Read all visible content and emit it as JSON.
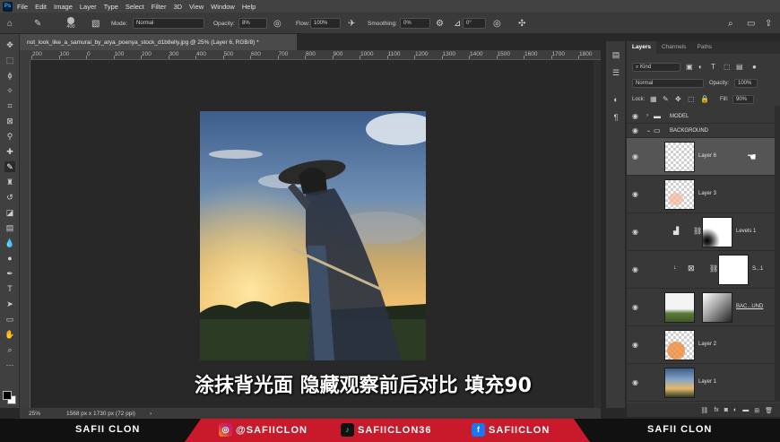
{
  "menu": {
    "logo": "Ps",
    "items": [
      "File",
      "Edit",
      "Image",
      "Layer",
      "Type",
      "Select",
      "Filter",
      "3D",
      "View",
      "Window",
      "Help"
    ]
  },
  "options": {
    "brush_size": "400",
    "mode_label": "Mode:",
    "mode_value": "Normal",
    "opacity_label": "Opacity:",
    "opacity_value": "8%",
    "flow_label": "Flow:",
    "flow_value": "100%",
    "smoothing_label": "Smoothing:",
    "smoothing_value": "0%",
    "angle_value": "0°"
  },
  "document": {
    "tab_title": "not_look_like_a_samurai_by_arya_poenya_stock_d1b8elly.jpg @ 25% (Layer 6, RGB/8) *",
    "ruler_labels": [
      "200",
      "100",
      "0",
      "100",
      "200",
      "300",
      "400",
      "500",
      "600",
      "700",
      "800",
      "900",
      "1000",
      "1100",
      "1200",
      "1300",
      "1400",
      "1500",
      "1600",
      "1700",
      "1800"
    ],
    "zoom": "25%",
    "doc_size": "1568 px x 1730 px (72 ppi)"
  },
  "subtitle": "涂抹背光面 隐藏观察前后对比 填充90",
  "layers_panel": {
    "tabs": [
      "Layers",
      "Channels",
      "Paths"
    ],
    "kind_label": "Kind",
    "blend_mode": "Normal",
    "opacity_label": "Opacity:",
    "opacity_value": "100%",
    "lock_label": "Lock:",
    "fill_label": "Fill:",
    "fill_value": "90%",
    "layers": [
      {
        "name": "MODEL",
        "type": "group"
      },
      {
        "name": "BACKGROUND",
        "type": "group"
      },
      {
        "name": "Layer 6",
        "type": "pixel",
        "selected": true
      },
      {
        "name": "Layer 3",
        "type": "pixel"
      },
      {
        "name": "Levels 1",
        "type": "adjustment"
      },
      {
        "name": "S...1",
        "type": "smart"
      },
      {
        "name": "BAC...UND",
        "type": "pixel"
      },
      {
        "name": "Layer 2",
        "type": "pixel"
      },
      {
        "name": "Layer 1",
        "type": "pixel"
      }
    ]
  },
  "banner": {
    "left_brand": "SAFII CLON",
    "right_brand": "SAFII CLON",
    "instagram": "@SAFIICLON",
    "tiktok": "SAFIICLON36",
    "facebook": "SAFIICLON",
    "colors": {
      "red": "#c81a2a",
      "dark": "#111111"
    }
  }
}
